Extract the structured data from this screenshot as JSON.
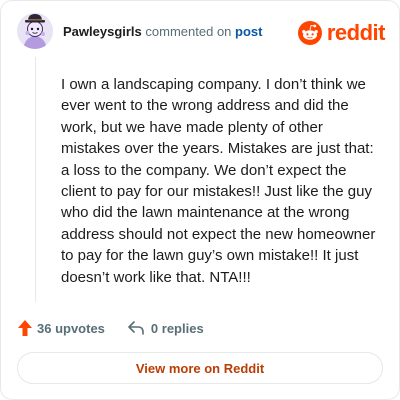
{
  "header": {
    "author": "Pawleysgirls",
    "action_text": "commented on",
    "post_link": "post",
    "logo_text": "reddit"
  },
  "comment": {
    "body": "I own a landscaping company. I don’t think we ever went to the wrong address and did the work, but we have made plenty of other mistakes over the years. Mistakes are just that: a loss to the company. We don’t expect the client to pay for our mistakes!! Just like the guy who did the lawn maintenance at the wrong address should not expect the new homeowner to pay for the lawn guy’s own mistake!! It just doesn’t work like that. NTA!!!"
  },
  "footer": {
    "upvotes": "36 upvotes",
    "replies": "0 replies",
    "view_more": "View more on Reddit"
  },
  "icons": {
    "upvote": "upvote-arrow-icon",
    "reply": "reply-arrow-icon",
    "reddit": "reddit-snoo-icon"
  },
  "colors": {
    "brand": "#ff4500",
    "upvote": "#ff4500",
    "link": "#0b57a4",
    "view_more": "#b93e06",
    "muted": "#576f76"
  }
}
